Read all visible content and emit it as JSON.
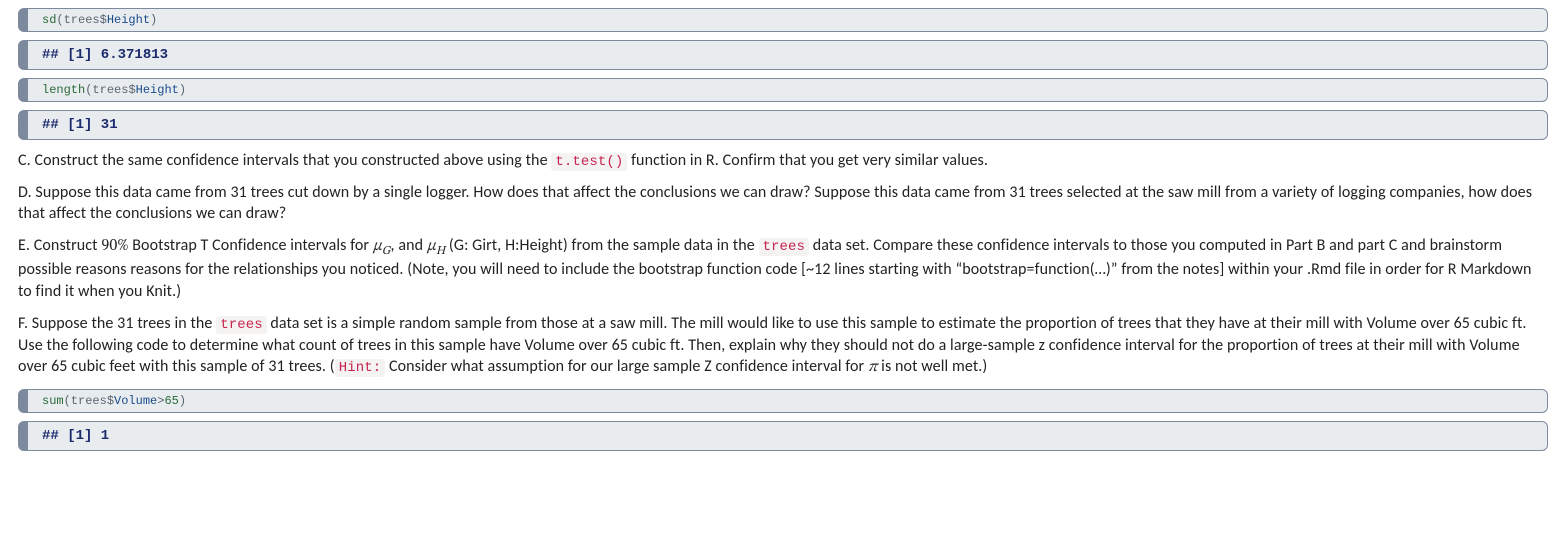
{
  "blocks": [
    {
      "kind": "code-input",
      "tokens": [
        {
          "cls": "tok-fn",
          "t": "sd"
        },
        {
          "cls": "tok-op",
          "t": "(trees"
        },
        {
          "cls": "tok-op",
          "t": "$"
        },
        {
          "cls": "tok-arg",
          "t": "Height"
        },
        {
          "cls": "tok-op",
          "t": ")"
        }
      ]
    },
    {
      "kind": "code-output",
      "text": "## [1] 6.371813"
    },
    {
      "kind": "code-input",
      "tokens": [
        {
          "cls": "tok-fn",
          "t": "length"
        },
        {
          "cls": "tok-op",
          "t": "(trees"
        },
        {
          "cls": "tok-op",
          "t": "$"
        },
        {
          "cls": "tok-arg",
          "t": "Height"
        },
        {
          "cls": "tok-op",
          "t": ")"
        }
      ]
    },
    {
      "kind": "code-output",
      "text": "## [1] 31"
    }
  ],
  "paraC": {
    "lead": "C. Construct the same confidence intervals that you constructed above using the ",
    "code": "t.test()",
    "tail": " function in R. Confirm that you get very similar values."
  },
  "paraD": "D. Suppose this data came from 31 trees cut down by a single logger. How does that affect the conclusions we can draw? Suppose this data came from 31 trees selected at the saw mill from a variety of logging companies, how does that affect the conclusions we can draw?",
  "paraE": {
    "s1": "E. Construct ",
    "pct": "90%",
    "s2": " Bootstrap T Confidence intervals for ",
    "muG": "μ",
    "subG": "G",
    "comma": ", and ",
    "muH": "μ",
    "subH": "H",
    "s3": " (G: Girt, H:Height) from the sample data in the ",
    "code": "trees",
    "s4": " data set. Compare these confidence intervals to those you computed in Part B and part C and brainstorm possible reasons reasons for the relationships you noticed. (Note, you will need to include the bootstrap function code [~12 lines starting with “bootstrap=function(…)” from the notes] within your .Rmd file in order for R Markdown to find it when you Knit.)"
  },
  "paraF": {
    "s1": "F. Suppose the 31 trees in the ",
    "code": "trees",
    "s2": " data set is a simple random sample from those at a saw mill. The mill would like to use this sample to estimate the proportion of trees that they have at their mill with Volume over 65 cubic ft. Use the following code to determine what count of trees in this sample have Volume over 65 cubic ft. Then, explain why they should not do a large-sample z confidence interval for the proportion of trees at their mill with Volume over 65 cubic feet with this sample of 31 trees. (",
    "hint": "Hint:",
    "s3": " Consider what assumption for our large sample Z confidence interval for ",
    "pi": "π",
    "s4": " is not well met.)"
  },
  "blocks2": [
    {
      "kind": "code-input",
      "tokens": [
        {
          "cls": "tok-fn",
          "t": "sum"
        },
        {
          "cls": "tok-op",
          "t": "(trees"
        },
        {
          "cls": "tok-op",
          "t": "$"
        },
        {
          "cls": "tok-arg",
          "t": "Volume"
        },
        {
          "cls": "tok-op",
          "t": ">"
        },
        {
          "cls": "tok-num",
          "t": "65"
        },
        {
          "cls": "tok-op",
          "t": ")"
        }
      ]
    },
    {
      "kind": "code-output",
      "text": "## [1] 1"
    }
  ]
}
